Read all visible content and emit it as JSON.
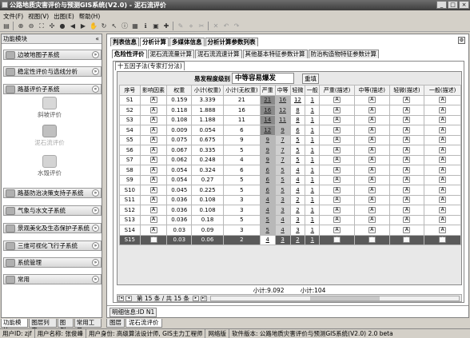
{
  "window": {
    "title": "公路地质灾害评价与预测GIS系统(V2.0) - 泥石流评价",
    "min": "_",
    "max": "□",
    "close": "×"
  },
  "menu": [
    "文件(F)",
    "视图(V)",
    "出图(E)",
    "帮助(H)"
  ],
  "left_panel": {
    "title": "功能模块",
    "pin": "«",
    "sections": [
      {
        "label": "边坡地图子系统",
        "chevron": "»"
      },
      {
        "label": "稳定性评价与选线分析",
        "chevron": "»"
      },
      {
        "label": "路基评价子系统",
        "chevron": "«"
      },
      {
        "label": "路基防治决策支持子系统",
        "chevron": "»"
      },
      {
        "label": "气象与水文子系统",
        "chevron": "»"
      },
      {
        "label": "景观美化及生态保护子系统",
        "chevron": "»"
      },
      {
        "label": "三维可视化飞行子系统",
        "chevron": "»"
      },
      {
        "label": "系统管理",
        "chevron": "»"
      },
      {
        "label": "常用",
        "chevron": "»"
      }
    ],
    "sub_items": [
      "斜坡评价",
      "泥石流评价",
      "水毁评价"
    ],
    "bottom_tabs": [
      "功能模块",
      "图层列表",
      "图例",
      "常用工具"
    ]
  },
  "top_tabs": [
    "判表信息",
    "分析计算",
    "多媒体信息",
    "分析计算参数列表"
  ],
  "sub_tabs": [
    "危险性评价",
    "泥石流流量计算",
    "泥石流流速计算",
    "其他基本特征参数计算",
    "防治构造物特征参数计算"
  ],
  "inner_tab": "十五因子法(专家打分法)",
  "result": {
    "label": "易发程度级别",
    "value": "中等容易爆发",
    "button": "重填"
  },
  "table": {
    "headers": [
      "序号",
      "影响因素",
      "权重",
      "小计(权重)",
      "小计(无权重)",
      "严重",
      "中等",
      "轻微",
      "一般",
      "严重(描述)",
      "中等(描述)",
      "轻微(描述)",
      "一般(描述)"
    ],
    "rows": [
      [
        "S1",
        "A",
        "0.159",
        "3.339",
        "21",
        "21",
        "16",
        "12",
        "1",
        "A",
        "A",
        "A",
        "A"
      ],
      [
        "S2",
        "A",
        "0.118",
        "1.888",
        "16",
        "16",
        "12",
        "8",
        "1",
        "A",
        "A",
        "A",
        "A"
      ],
      [
        "S3",
        "A",
        "0.108",
        "1.188",
        "11",
        "14",
        "11",
        "8",
        "1",
        "A",
        "A",
        "A",
        "A"
      ],
      [
        "S4",
        "A",
        "0.009",
        "0.054",
        "6",
        "12",
        "9",
        "6",
        "1",
        "A",
        "A",
        "A",
        "A"
      ],
      [
        "S5",
        "A",
        "0.075",
        "0.675",
        "9",
        "9",
        "7",
        "5",
        "1",
        "A",
        "A",
        "A",
        "A"
      ],
      [
        "S6",
        "A",
        "0.067",
        "0.335",
        "5",
        "9",
        "7",
        "5",
        "1",
        "A",
        "A",
        "A",
        "A"
      ],
      [
        "S7",
        "A",
        "0.062",
        "0.248",
        "4",
        "9",
        "7",
        "5",
        "1",
        "A",
        "A",
        "A",
        "A"
      ],
      [
        "S8",
        "A",
        "0.054",
        "0.324",
        "6",
        "6",
        "5",
        "4",
        "1",
        "A",
        "A",
        "A",
        "A"
      ],
      [
        "S9",
        "A",
        "0.054",
        "0.27",
        "5",
        "6",
        "5",
        "4",
        "1",
        "A",
        "A",
        "A",
        "A"
      ],
      [
        "S10",
        "A",
        "0.045",
        "0.225",
        "5",
        "6",
        "5",
        "4",
        "1",
        "A",
        "A",
        "A",
        "A"
      ],
      [
        "S11",
        "A",
        "0.036",
        "0.108",
        "3",
        "4",
        "3",
        "2",
        "1",
        "A",
        "A",
        "A",
        "A"
      ],
      [
        "S12",
        "A",
        "0.036",
        "0.108",
        "3",
        "4",
        "3",
        "2",
        "1",
        "A",
        "A",
        "A",
        "A"
      ],
      [
        "S13",
        "A",
        "0.036",
        "0.18",
        "5",
        "5",
        "4",
        "3",
        "1",
        "A",
        "A",
        "A",
        "A"
      ],
      [
        "S14",
        "A",
        "0.03",
        "0.09",
        "3",
        "5",
        "4",
        "3",
        "1",
        "A",
        "A",
        "A",
        "A"
      ],
      [
        "S15",
        "A",
        "0.03",
        "0.06",
        "2",
        "4",
        "3",
        "2",
        "1",
        "A",
        "A",
        "A",
        "A"
      ]
    ],
    "selected_row": 14
  },
  "totals": {
    "weighted": "小计:9.092",
    "unweighted": "小计:104"
  },
  "pager": {
    "text": "第 15 条 / 共 15 条",
    "first": "|◂",
    "prev": "◂",
    "next": "▸",
    "last": "▸|"
  },
  "detail_tab": "明细信息:ID N1",
  "mid_tabs": [
    "图层",
    "泥石流评价"
  ],
  "statusbar": [
    "用户ID: zjf",
    "用户名称: 张俊峰",
    "用户身份: 高级算法设计师, GIS主力工程师",
    "网络版",
    "软件版本: 公路地质灾害评价与预测GIS系统(V2.0) 2.0 beta"
  ],
  "colors": {
    "dark_cell": "#8a8a8a",
    "mid_cell": "#b8b8b8",
    "selected_row": "#5a5a5a"
  }
}
